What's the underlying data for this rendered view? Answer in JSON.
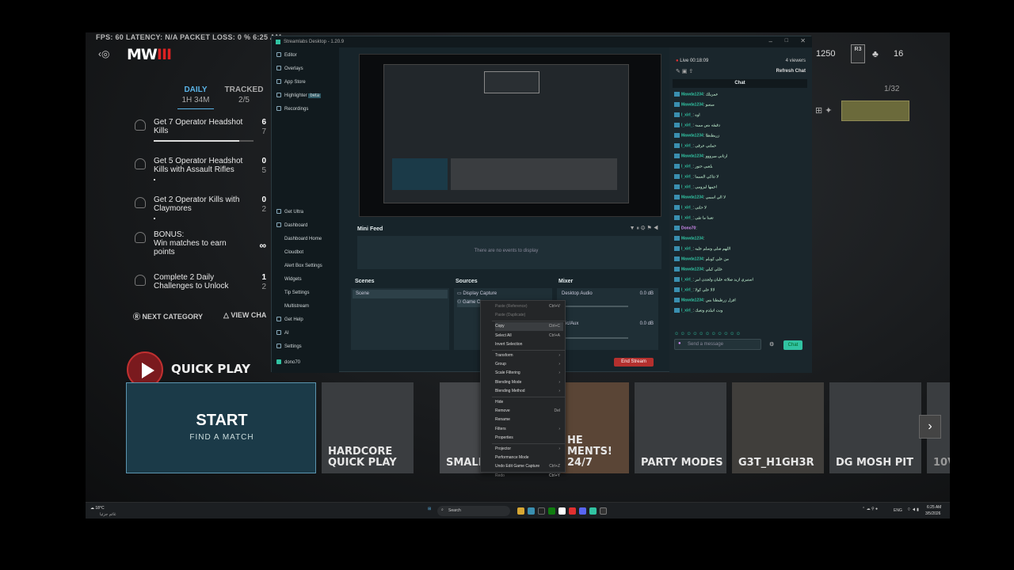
{
  "hud": {
    "stats": "FPS: 60   LATENCY: N/A   PACKET LOSS: 0 %   6:25 AM",
    "logo_main": "MW",
    "logo_accent": "III",
    "currency": "1250",
    "rank_badge": "R3",
    "players": "16",
    "page_counter": "1/32"
  },
  "challenges": {
    "tab_daily": "DAILY",
    "tab_daily_sub": "1H 34M",
    "tab_tracked": "TRACKED",
    "tab_tracked_sub": "2/5",
    "items": [
      {
        "title": "Get 7 Operator Headshot Kills",
        "progress": "6",
        "total": "7"
      },
      {
        "title": "Get 5 Operator Headshot Kills with Assault Rifles",
        "progress": "0",
        "total": "5"
      },
      {
        "title": "Get 2 Operator Kills with Claymores",
        "progress": "0",
        "total": "2"
      },
      {
        "title": "BONUS:",
        "subtitle": "Win matches to earn points",
        "progress": "∞",
        "total": ""
      },
      {
        "title": "Complete 2 Daily Challenges to Unlock",
        "progress": "1",
        "total": "2"
      }
    ],
    "next_category": "NEXT CATEGORY",
    "view_challenges": "VIEW CHA"
  },
  "quick_play": {
    "title": "QUICK PLAY",
    "start": "START",
    "find_match": "FIND A MATCH",
    "tiles": [
      "HARDCORE QUICK PLAY",
      "SMALL M PIT",
      "HE MENTS! 24/7",
      "PARTY MODES",
      "G3T_H1GH3R",
      "DG MOSH PIT",
      "10V"
    ]
  },
  "streamlabs": {
    "window_title": "Streamlabs Desktop - 1.20.9",
    "nav_top": [
      "Editor",
      "Overlays",
      "App Store",
      "Highlighter",
      "Recordings"
    ],
    "highlighter_badge": "beta",
    "nav_bottom": [
      "Get Ultra",
      "Dashboard",
      "Dashboard Home",
      "Cloudbot",
      "Alert Box Settings",
      "Widgets",
      "Tip Settings",
      "Multistream",
      "Get Help",
      "AI",
      "Settings",
      "dono70"
    ],
    "mini_feed_title": "Mini Feed",
    "mini_feed_empty": "There are no events to display",
    "scenes_title": "Scenes",
    "scene_item": "Scene",
    "sources_title": "Sources",
    "source_items": [
      "Display Capture",
      "Game C"
    ],
    "mixer_title": "Mixer",
    "mixer_items": [
      {
        "name": "Desktop Audio",
        "db": "0.0 dB"
      },
      {
        "name": "Mic/Aux",
        "db": "0.0 dB"
      }
    ],
    "end_stream": "End Stream",
    "live_status": "Live 00:18:09",
    "viewers": "4 viewers",
    "refresh_chat": "Refresh Chat",
    "chat_title": "Chat",
    "chat_placeholder": "Send a message",
    "chat_button": "Chat",
    "chat_messages": [
      {
        "user": "Mawda1234",
        "text": "عمريلك"
      },
      {
        "user": "Mawda1234",
        "text": "ميسو"
      },
      {
        "user": "l_xirl_",
        "text": "اوه"
      },
      {
        "user": "l_xirl_",
        "text": "دقيقه بس مبيبه"
      },
      {
        "user": "Mawda1234",
        "text": "زريطنطا"
      },
      {
        "user": "l_xirl_",
        "text": "حملتي عرقي"
      },
      {
        "user": "Mawda1234",
        "text": "ارتاني ميرووو"
      },
      {
        "user": "l_xirl_",
        "text": "يلعبي حتور"
      },
      {
        "user": "l_xirl_",
        "text": "لا تتاكي السيما"
      },
      {
        "user": "l_xirl_",
        "text": "اجيبها ليزومي"
      },
      {
        "user": "Mawda1234",
        "text": "لا الي اسمي"
      },
      {
        "user": "l_xirl_",
        "text": "لا حلتي"
      },
      {
        "user": "l_xirl_",
        "text": "تعبنا ما تقي"
      },
      {
        "user": "Dono70",
        "text": ""
      },
      {
        "user": "Mawda1234",
        "text": ""
      },
      {
        "user": "l_xirl_",
        "text": "اللهم صلي وسلم عليه"
      },
      {
        "user": "Mawda1234",
        "text": "من علي كوبلم"
      },
      {
        "user": "Mawda1234",
        "text": "عللي كيلي"
      },
      {
        "user": "l_xirl_",
        "text": "استيري ازيد صلاته عليان ولعتدن امر"
      },
      {
        "user": "l_xirl_",
        "text": "لالا علي كولا"
      },
      {
        "user": "Mawda1234",
        "text": "افزل زرطيطنا بس"
      },
      {
        "user": "l_xirl_",
        "text": "ونت اتيلدم وتعبك"
      }
    ]
  },
  "context_menu": {
    "items": [
      {
        "label": "Paste (Reference)",
        "shortcut": "Ctrl+V",
        "disabled": true
      },
      {
        "label": "Paste (Duplicate)",
        "shortcut": "",
        "disabled": true
      },
      {
        "label": "Copy",
        "shortcut": "Ctrl+C",
        "hover": true
      },
      {
        "label": "Select All",
        "shortcut": "Ctrl+A"
      },
      {
        "label": "Invert Selection",
        "shortcut": ""
      },
      {
        "label": "Transform",
        "shortcut": "›"
      },
      {
        "label": "Group",
        "shortcut": "›"
      },
      {
        "label": "Scale Filtering",
        "shortcut": "›"
      },
      {
        "label": "Blending Mode",
        "shortcut": "›"
      },
      {
        "label": "Blending Method",
        "shortcut": "›"
      },
      {
        "label": "Hide",
        "shortcut": ""
      },
      {
        "label": "Remove",
        "shortcut": "Del"
      },
      {
        "label": "Rename",
        "shortcut": ""
      },
      {
        "label": "Filters",
        "shortcut": "›"
      },
      {
        "label": "Properties",
        "shortcut": ""
      },
      {
        "label": "Projector",
        "shortcut": "›"
      },
      {
        "label": "Performance Mode",
        "shortcut": ""
      },
      {
        "label": "Undo Edit Game Capture",
        "shortcut": "Ctrl+Z"
      },
      {
        "label": "Redo",
        "shortcut": "Ctrl+Y",
        "disabled": true
      }
    ]
  },
  "taskbar": {
    "weather_temp": "18°C",
    "weather_desc": "غائم جزئيا",
    "search": "Search",
    "lang": "ENG",
    "time": "6:25 AM",
    "date": "3/5/2026"
  },
  "colors": {
    "accent_green": "#31c3a2",
    "live_red": "#e03030",
    "end_stream": "#b4302e"
  }
}
